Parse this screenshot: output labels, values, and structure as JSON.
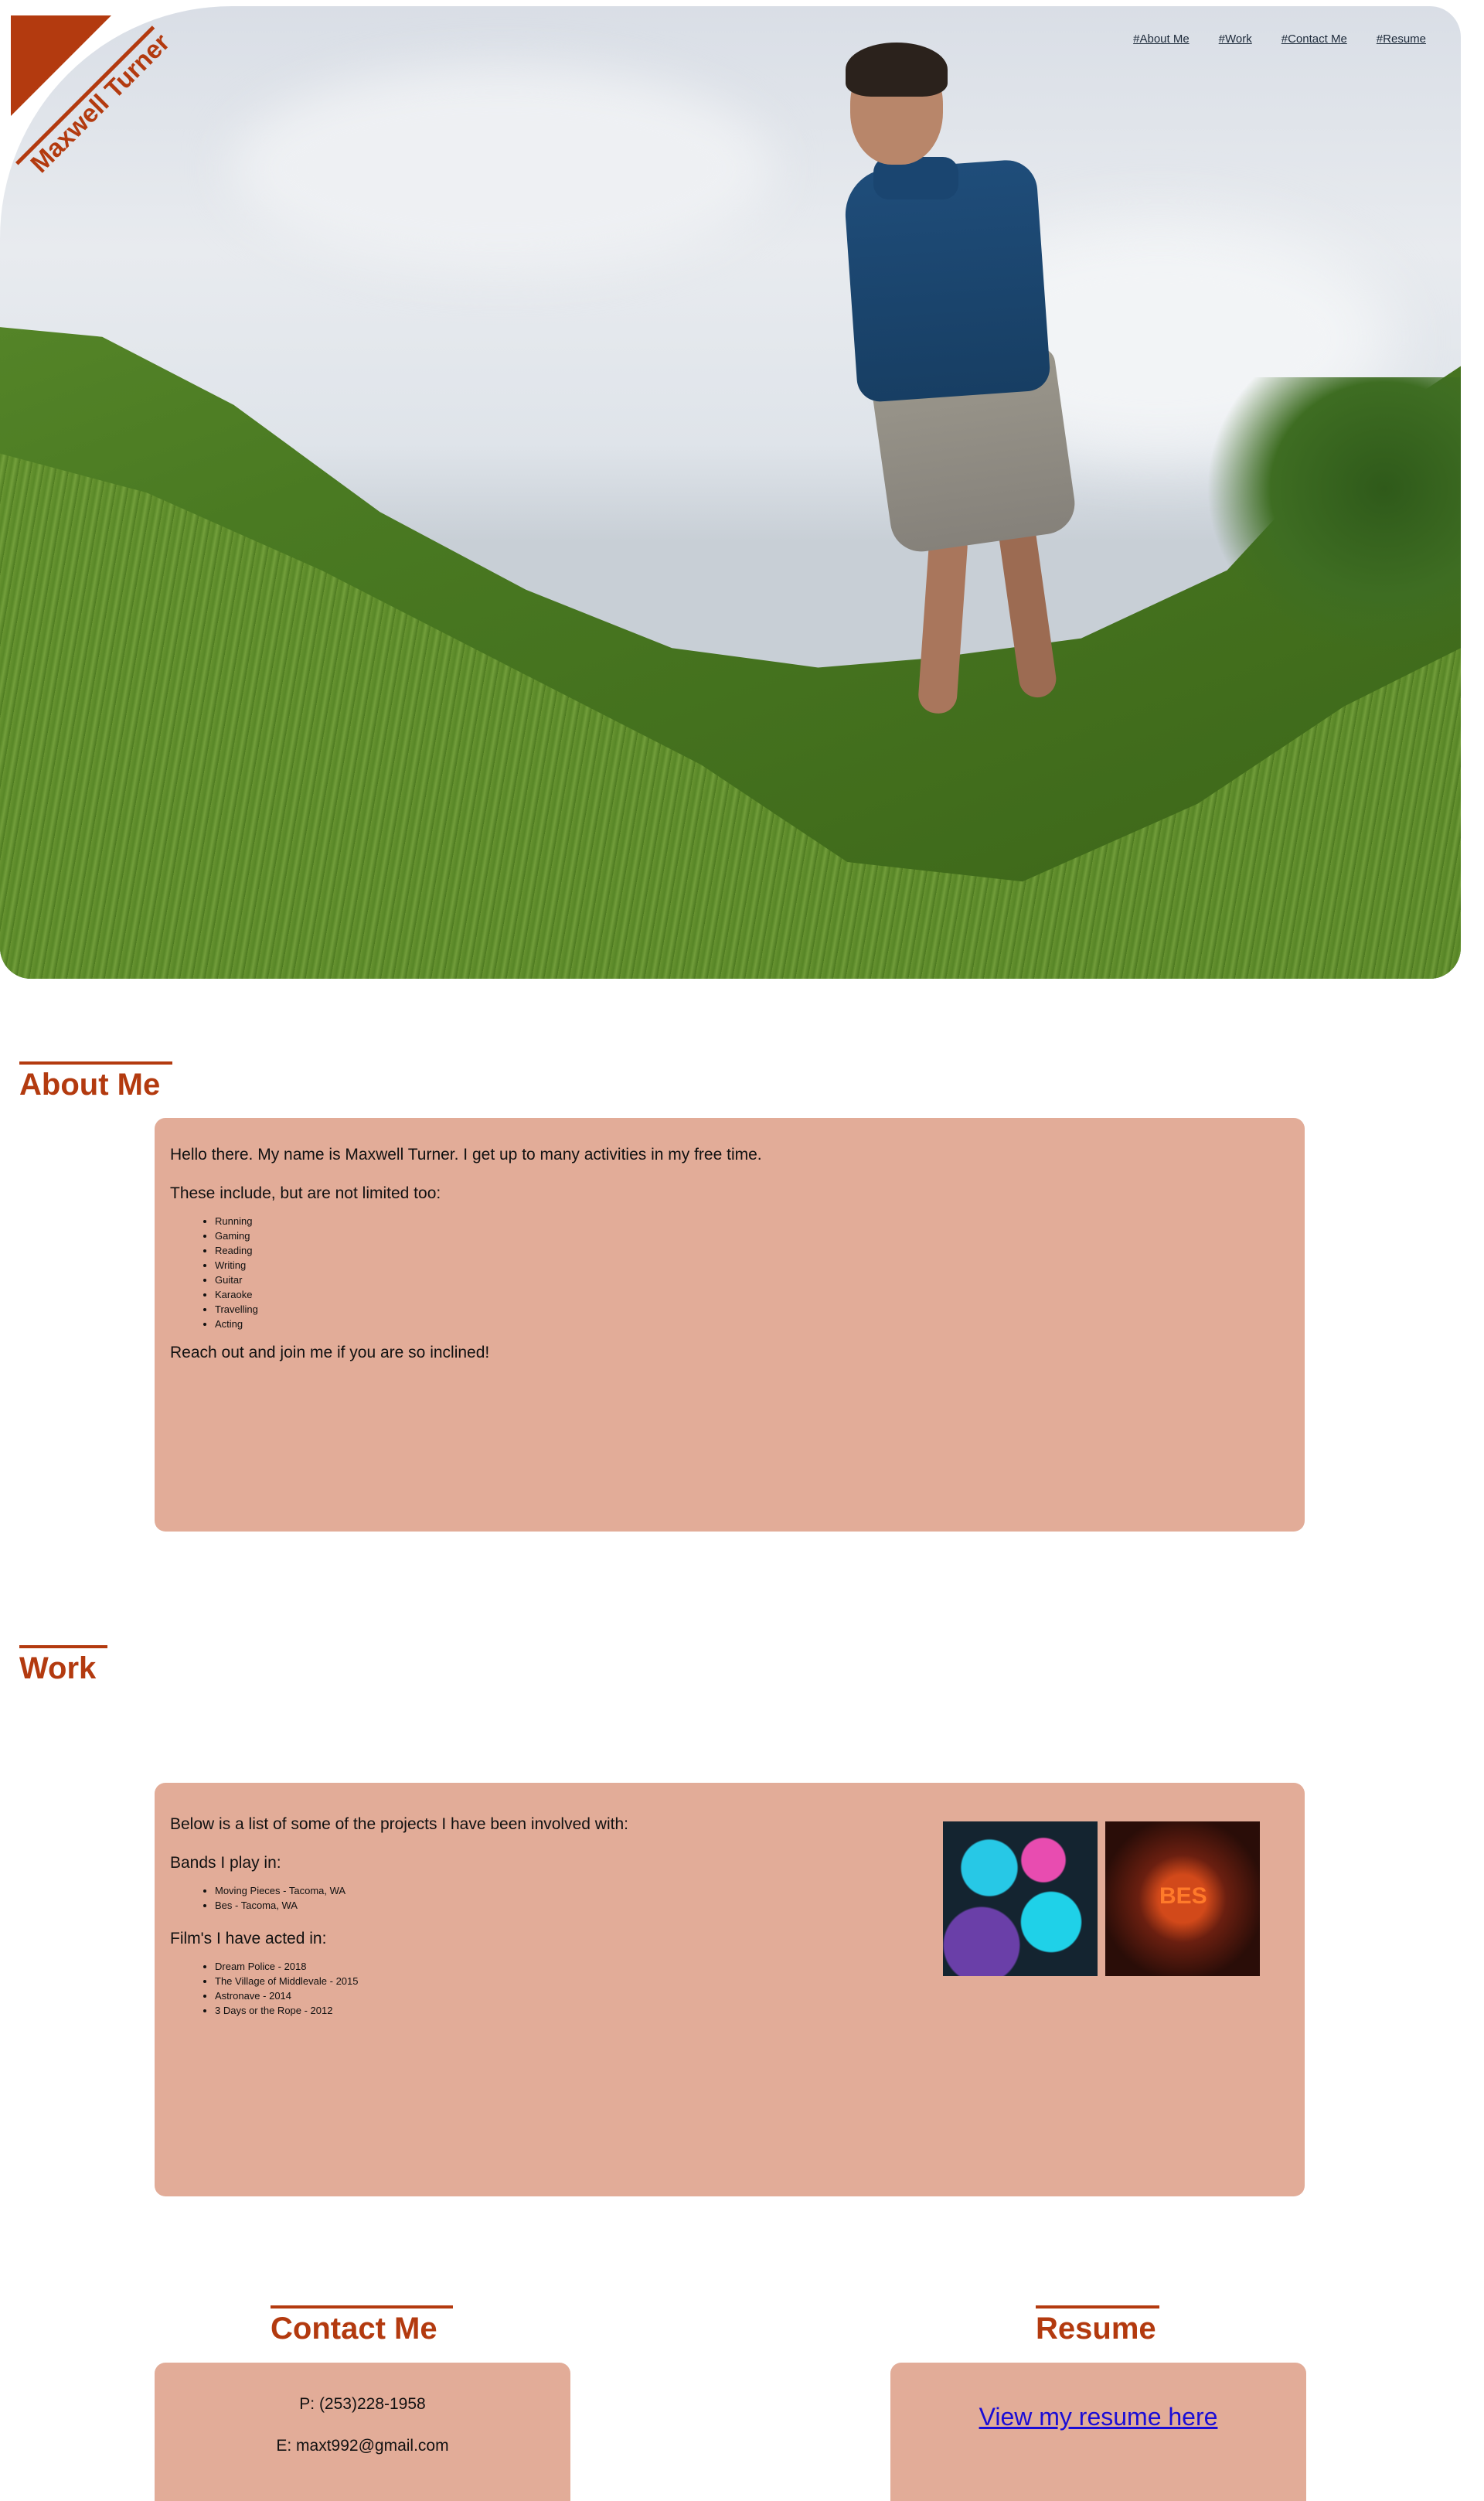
{
  "brand": {
    "name": "Maxwell Turner",
    "color": "#b33a0f"
  },
  "nav": [
    {
      "label": "#About Me"
    },
    {
      "label": "#Work"
    },
    {
      "label": "#Contact Me"
    },
    {
      "label": "#Resume"
    }
  ],
  "about": {
    "heading": "About Me",
    "intro": "Hello there. My name is Maxwell Turner. I get up to many activities in my free time.",
    "lead": "These include, but are not limited too:",
    "activities": [
      "Running",
      "Gaming",
      "Reading",
      "Writing",
      "Guitar",
      "Karaoke",
      "Travelling",
      "Acting"
    ],
    "outro": "Reach out and join me if you are so inclined!"
  },
  "work": {
    "heading": "Work",
    "intro": "Below is a list of some of the projects I have been involved with:",
    "bands_label": "Bands I play in:",
    "bands": [
      "Moving Pieces - Tacoma, WA",
      "Bes - Tacoma, WA"
    ],
    "films_label": "Film's I have acted in:",
    "films": [
      "Dream Police - 2018",
      "The Village of Middlevale - 2015",
      "Astronave - 2014",
      "3 Days or the Rope - 2012"
    ],
    "thumbs": [
      {
        "icon": "moving-pieces-album-art"
      },
      {
        "icon": "bes-album-art",
        "text": "BES"
      }
    ]
  },
  "contact": {
    "heading": "Contact Me",
    "phone": "P: (253)228-1958",
    "email": "E: maxt992@gmail.com"
  },
  "resume": {
    "heading": "Resume",
    "link": "View my resume here"
  },
  "colors": {
    "card": "#e2ac98",
    "accent": "#b33a0f"
  }
}
